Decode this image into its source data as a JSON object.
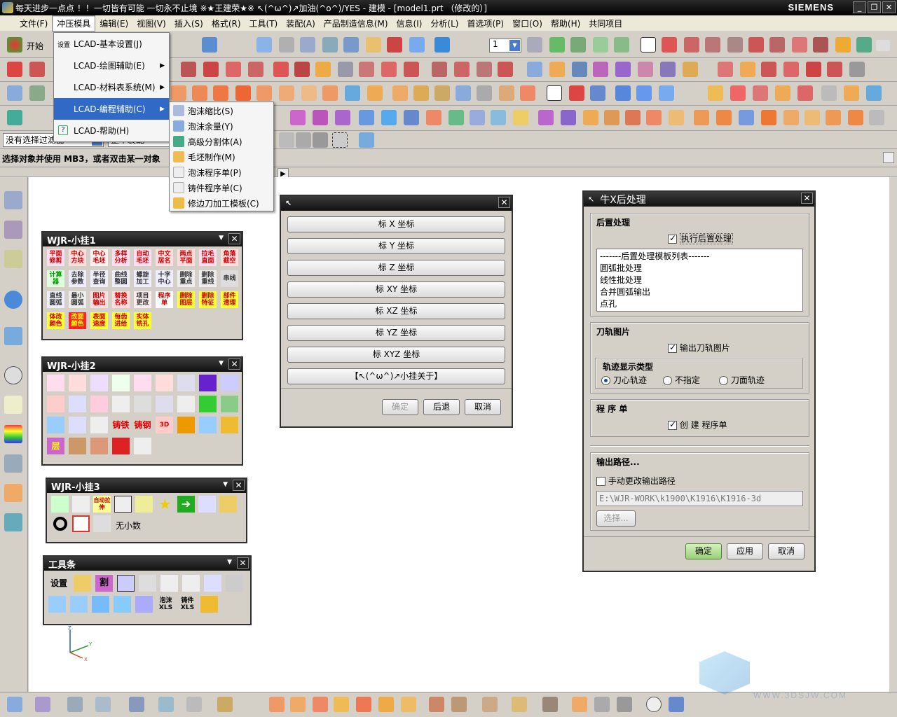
{
  "window": {
    "title": "每天进步一点点 ！！一切皆有可能 一切永不止境 ※★王建荣★※ ↖(^ω^)↗加油(^o^)/YES - 建模 - [model1.prt （修改的）]",
    "brand": "SIEMENS"
  },
  "menubar": [
    "文件(F)",
    "冲压模具",
    "编辑(E)",
    "视图(V)",
    "插入(S)",
    "格式(R)",
    "工具(T)",
    "装配(A)",
    "产品制造信息(M)",
    "信息(I)",
    "分析(L)",
    "首选项(P)",
    "窗口(O)",
    "帮助(H)",
    "共同项目"
  ],
  "toolbar": {
    "start_label": "开始",
    "layer_value": "1",
    "filter_value": "没有选择过滤器",
    "filter2_value": "整个装配",
    "status": "选择对象并使用 MB3，或者双击某一对象"
  },
  "menu": {
    "items": [
      {
        "label": "LCAD-基本设置(J)",
        "icon": "设置"
      },
      {
        "label": "LCAD-绘图辅助(E)"
      },
      {
        "label": "LCAD-材料表系统(M)"
      },
      {
        "label": "LCAD-编程辅助(C)"
      },
      {
        "label": "LCAD-帮助(H)"
      }
    ],
    "submenu": [
      "泡沫缩比(S)",
      "泡沫余量(Y)",
      "高级分割体(A)",
      "毛坯制作(M)",
      "泡沫程序单(P)",
      "铸件程序单(C)",
      "修边刀加工模板(C)"
    ]
  },
  "panels": {
    "wjr1": {
      "title": "WJR-小挂1",
      "items": [
        "平面修剪",
        "中心方块",
        "中心毛坯",
        "多样分析",
        "自动毛坯",
        "中文居名",
        "两点平面",
        "拉毛直面",
        "角落截空",
        "计算器",
        "去除参数",
        "半径查询",
        "曲线整圆",
        "螺旋加工",
        "十字中心",
        "删除重点",
        "删除重线",
        "串线",
        "直线圆弧",
        "最小圆弧",
        "图片输出",
        "替换名称",
        "项目更改",
        "程序单",
        "删除图层",
        "删除特征",
        "部件清理",
        "体改颜色",
        "改面颜色",
        "表面速度",
        "每齿进给",
        "实体铣孔"
      ]
    },
    "wjr2": {
      "title": "WJR-小挂2",
      "items": [
        "铸铁",
        "铸钢"
      ]
    },
    "wjr3": {
      "title": "WJR-小挂3",
      "no_decimal": "无小数",
      "auto_stretch": "自动拉伸"
    },
    "tools": {
      "title": "工具条",
      "items": [
        "设置",
        "割",
        "泡沫XLS",
        "铸件XLS"
      ]
    }
  },
  "coord_dialog": {
    "buttons": [
      "标 X 坐标",
      "标 Y 坐标",
      "标 Z 坐标",
      "标 XY 坐标",
      "标 XZ 坐标",
      "标 YZ 坐标",
      "标 XYZ 坐标",
      "【↖(^ω^)↗小挂关于】"
    ],
    "ok": "确定",
    "back": "后退",
    "cancel": "取消"
  },
  "post_dialog": {
    "title": "牛X后处理",
    "sec1": "后置处理",
    "exec_post": "执行后置处理",
    "list": [
      "-------后置处理模板列表-------",
      "圆弧批处理",
      "线性批处理",
      "合并圆弧输出",
      "点孔"
    ],
    "sec2": "刀轨图片",
    "output_pic": "输出刀轨图片",
    "track_type": "轨迹显示类型",
    "radios": [
      "刀心轨迹",
      "不指定",
      "刀面轨迹"
    ],
    "sec3": "程 序 单",
    "create_sheet": "创 建  程序单",
    "sec4": "输出路径...",
    "manual_path": "手动更改输出路径",
    "path": "E:\\WJR-WORK\\k1900\\K1916\\K1916-3d",
    "choose": "选择...",
    "ok": "确定",
    "apply": "应用",
    "cancel": "取消"
  },
  "watermark": "WWW.3DSJW.COM"
}
